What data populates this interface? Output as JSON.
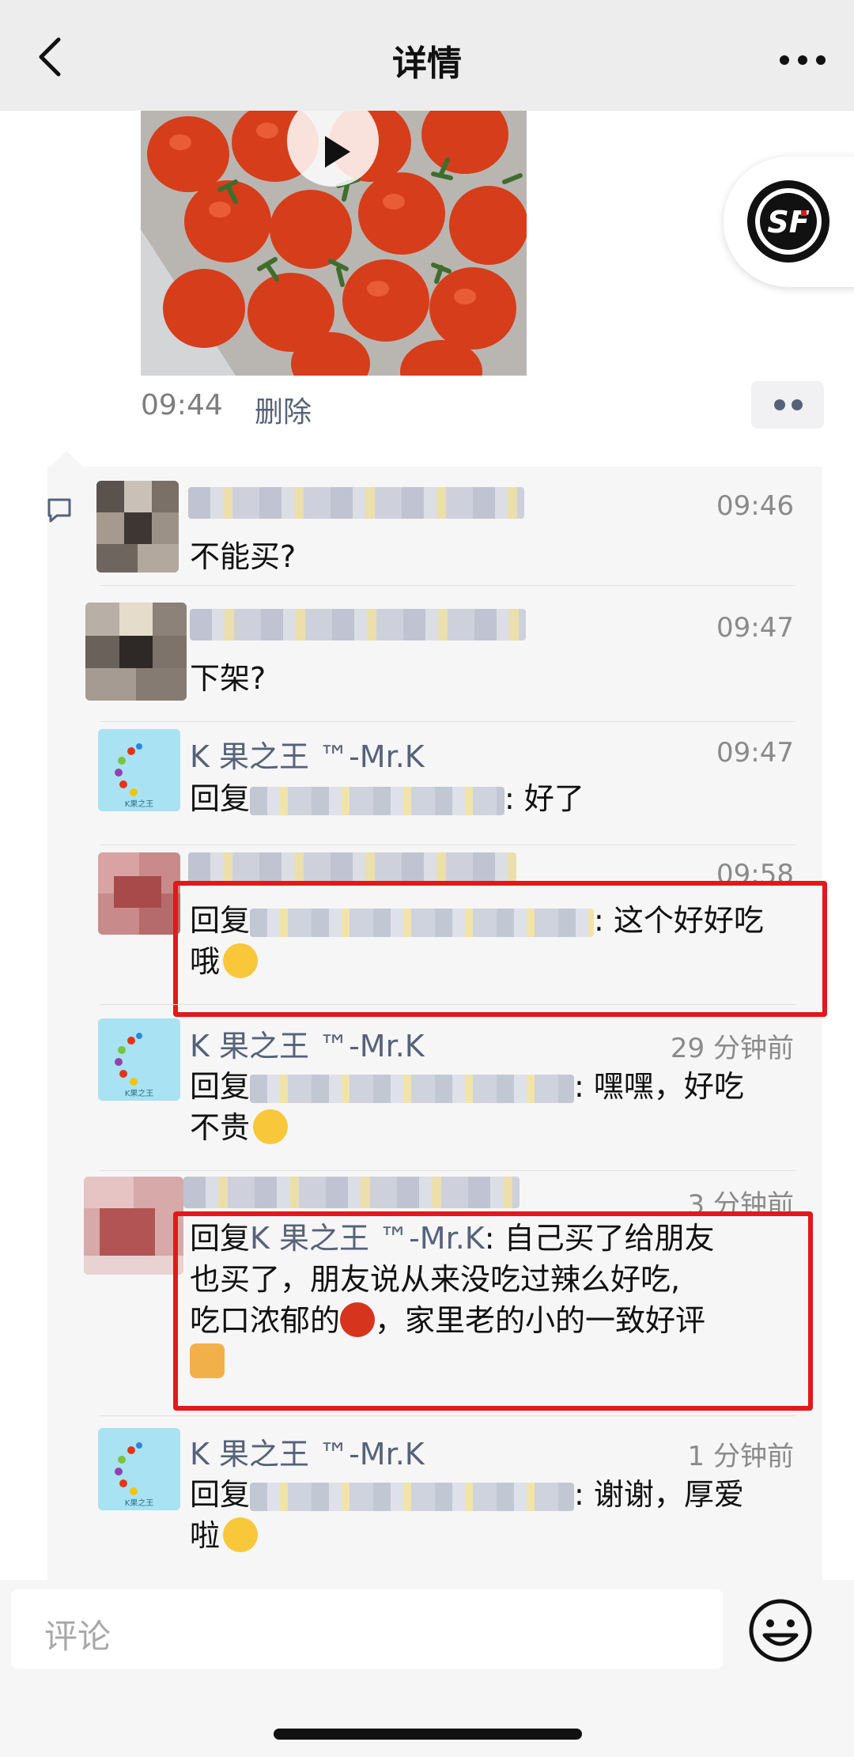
{
  "header": {
    "title": "详情"
  },
  "post": {
    "time": "09:44",
    "delete_label": "删除"
  },
  "comments": [
    {
      "name": "",
      "time": "09:46",
      "text": "不能买?"
    },
    {
      "name": "",
      "time": "09:47",
      "text": "下架?"
    },
    {
      "name": "K 果之王 ™-Mr.K",
      "time": "09:47",
      "reply_prefix": "回复",
      "reply_suffix": ": 好了"
    },
    {
      "name": "",
      "time": "09:58",
      "reply_prefix": "回复",
      "reply_suffix": ": 这个好好吃",
      "line2": "哦"
    },
    {
      "name": "K 果之王 ™-Mr.K",
      "time": "29 分钟前",
      "reply_prefix": "回复",
      "reply_suffix": ": 嘿嘿，好吃",
      "line2": "不贵"
    },
    {
      "name": "",
      "time": "3 分钟前",
      "reply_prefix": "回复",
      "reply_target": "K 果之王 ™-Mr.K",
      "line1_rest": ": 自己买了给朋友",
      "line2": "也买了，朋友说从来没吃过辣么好吃,",
      "line3a": "吃口浓郁的",
      "line3b": "，家里老的小的一致好评"
    },
    {
      "name": "K 果之王 ™-Mr.K",
      "time": "1 分钟前",
      "reply_prefix": "回复",
      "reply_suffix": ": 谢谢，厚爱",
      "line2": "啦"
    }
  ],
  "avatar_brand_text": "K果之王",
  "input": {
    "placeholder": "评论"
  },
  "colors": {
    "link": "#56627a",
    "highlight_border": "#e3181b",
    "sf_red": "#e3181b"
  },
  "icons": [
    "back-icon",
    "more-icon",
    "play-icon",
    "sf-express-icon",
    "comment-icon",
    "emoji-icon"
  ]
}
